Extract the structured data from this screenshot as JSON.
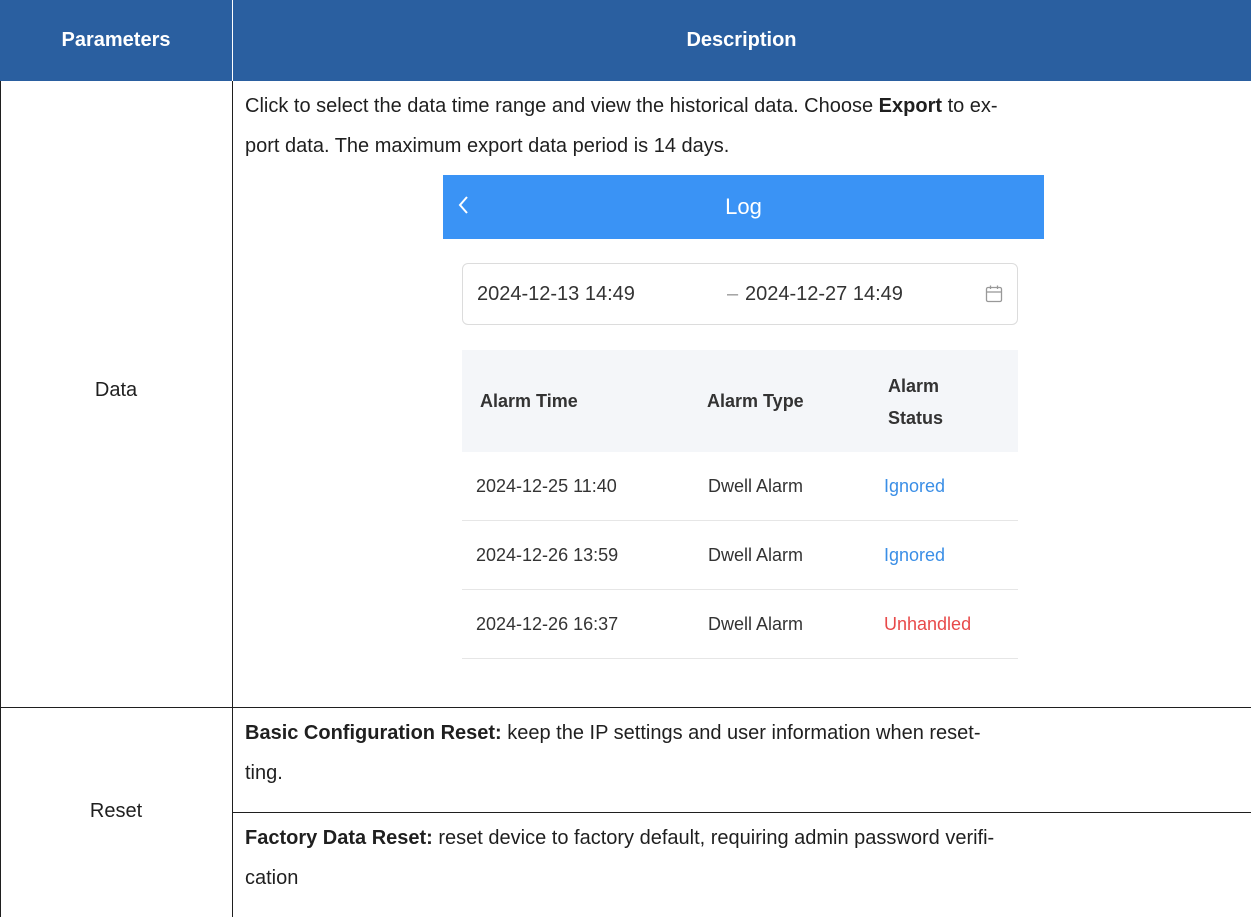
{
  "header": {
    "parameters": "Parameters",
    "description": "Description"
  },
  "rows": {
    "data": {
      "param": "Data",
      "desc_part1": "Click to select the data time range and view the historical data. Choose ",
      "desc_bold": "Export",
      "desc_part2": " to ex-",
      "desc_line2": "port data. The maximum export data period is 14 days."
    },
    "reset": {
      "param": "Reset",
      "basic_bold": "Basic Configuration Reset:",
      "basic_text": " keep the IP settings and user information when reset-",
      "basic_line2": "ting.",
      "factory_bold": "Factory Data Reset:",
      "factory_text": " reset device to factory default, requiring admin password verifi-",
      "factory_line2": "cation"
    }
  },
  "app": {
    "title": "Log",
    "back_icon": "chevron-left-icon",
    "calendar_icon": "calendar-icon",
    "range_from": "2024-12-13 14:49",
    "range_sep": "–",
    "range_to": "2024-12-27 14:49",
    "columns": {
      "time": "Alarm Time",
      "type": "Alarm Type",
      "status_1": "Alarm",
      "status_2": "Status"
    },
    "entries": [
      {
        "time": "2024-12-25 11:40",
        "type": "Dwell Alarm",
        "status": "Ignored"
      },
      {
        "time": "2024-12-26 13:59",
        "type": "Dwell Alarm",
        "status": "Ignored"
      },
      {
        "time": "2024-12-26 16:37",
        "type": "Dwell Alarm",
        "status": "Unhandled"
      }
    ],
    "colors": {
      "bar": "#3a93f5",
      "ignored": "#3a8ee6",
      "unhandled": "#e84a4a"
    }
  },
  "theme": {
    "header_bg": "#2a5fa0"
  }
}
